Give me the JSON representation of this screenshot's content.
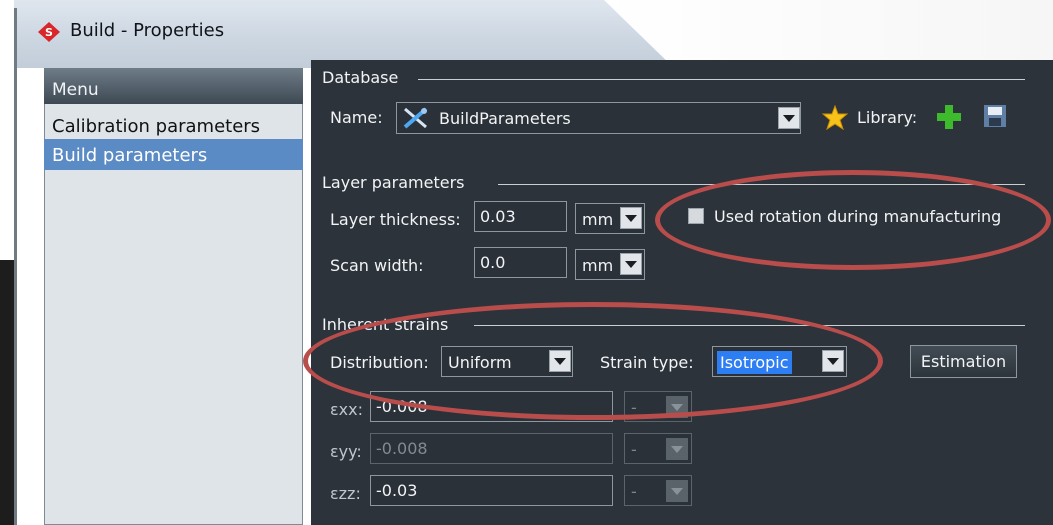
{
  "window": {
    "title": "Build - Properties"
  },
  "menu": {
    "header": "Menu",
    "items": [
      {
        "label": "Calibration parameters",
        "selected": false
      },
      {
        "label": "Build parameters",
        "selected": true
      }
    ]
  },
  "database": {
    "group_label": "Database",
    "name_label": "Name:",
    "name_value": "BuildParameters",
    "library_label": "Library:"
  },
  "layer": {
    "group_label": "Layer parameters",
    "thickness_label": "Layer thickness:",
    "thickness_value": "0.03",
    "thickness_unit": "mm",
    "scan_label": "Scan width:",
    "scan_value": "0.0",
    "scan_unit": "mm",
    "rotation_label": "Used rotation during manufacturing",
    "rotation_checked": false
  },
  "strains": {
    "group_label": "Inherent strains",
    "distribution_label": "Distribution:",
    "distribution_value": "Uniform",
    "strain_type_label": "Strain type:",
    "strain_type_value": "Isotropic",
    "estimation_label": "Estimation",
    "exx": {
      "label": "εxx:",
      "value": "-0.008",
      "unit": "-"
    },
    "eyy": {
      "label": "εyy:",
      "value": "-0.008",
      "unit": "-"
    },
    "ezz": {
      "label": "εzz:",
      "value": "-0.03",
      "unit": "-"
    }
  },
  "colors": {
    "panel_bg": "#2c333b",
    "selection": "#5a8bc4",
    "highlight": "#2d7df3",
    "annotation": "#b84d4b"
  }
}
